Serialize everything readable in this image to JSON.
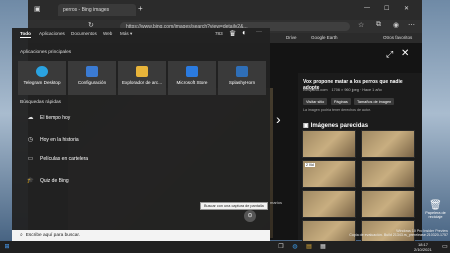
{
  "browser": {
    "tabs": [
      "perros - Bing images"
    ],
    "new_tab": "+",
    "window_controls": {
      "minimize": "—",
      "maximize": "☐",
      "close": "✕"
    },
    "url": "https://www.bing.com/images/search?view=detailv2&...",
    "favorites": [
      "Drive",
      "Google Earth",
      "Otros favoritos"
    ]
  },
  "viewer": {
    "panel_title": "Vox propone matar a los perros que nadie adopte",
    "panel_source": "elespanol.com",
    "panel_meta": "1706 × 960 jpeg · Hace 1 año",
    "buttons": [
      "Visitar sitio",
      "Páginas",
      "Tamaños de imagen"
    ],
    "note": "La imagen podría tener derechos de autor.",
    "related_title": "Imágenes parecidas",
    "badge": "2 Vid",
    "caption_fragment": "marios"
  },
  "start_menu": {
    "tabs": [
      "Todo",
      "Aplicaciones",
      "Documentos",
      "Web",
      "Más ▾"
    ],
    "score": "783",
    "more_icon": "···",
    "apps_heading": "Aplicaciones principales",
    "apps": [
      {
        "label": "Telegram Desktop",
        "icon": "telegram-icon",
        "color": "#2aa3e1"
      },
      {
        "label": "Configuración",
        "icon": "gear-icon",
        "color": "#3b7bd3"
      },
      {
        "label": "Explorador de arc...",
        "icon": "folder-icon",
        "color": "#e8b43a"
      },
      {
        "label": "Microsoft Store",
        "icon": "store-icon",
        "color": "#2b7be0"
      },
      {
        "label": "SplashyHorn",
        "icon": "app-icon",
        "color": "#2f6fb8"
      }
    ],
    "quick_heading": "Búsquedas rápidas",
    "quick": [
      {
        "label": "El tiempo hoy",
        "icon": "weather-icon",
        "glyph": "☁"
      },
      {
        "label": "Hoy en la historia",
        "icon": "clock-icon",
        "glyph": "◷"
      },
      {
        "label": "Películas en cartelera",
        "icon": "movie-icon",
        "glyph": "▭"
      },
      {
        "label": "Quiz de Bing",
        "icon": "graduation-cap-icon",
        "glyph": "🎓"
      }
    ],
    "tooltip": "Buscar con una captura de pantalla"
  },
  "taskbar": {
    "search_placeholder": "Escribe aquí para buscar.",
    "time": "18:17",
    "date": "2/10/2021"
  },
  "desktop": {
    "recycle_label": "Papelera de reciclaje",
    "watermark_1": "Windows 10 Pro Insider Preview",
    "watermark_2": "Copia de evaluación. Build 21343.rs_prerelease.210320-1757"
  }
}
